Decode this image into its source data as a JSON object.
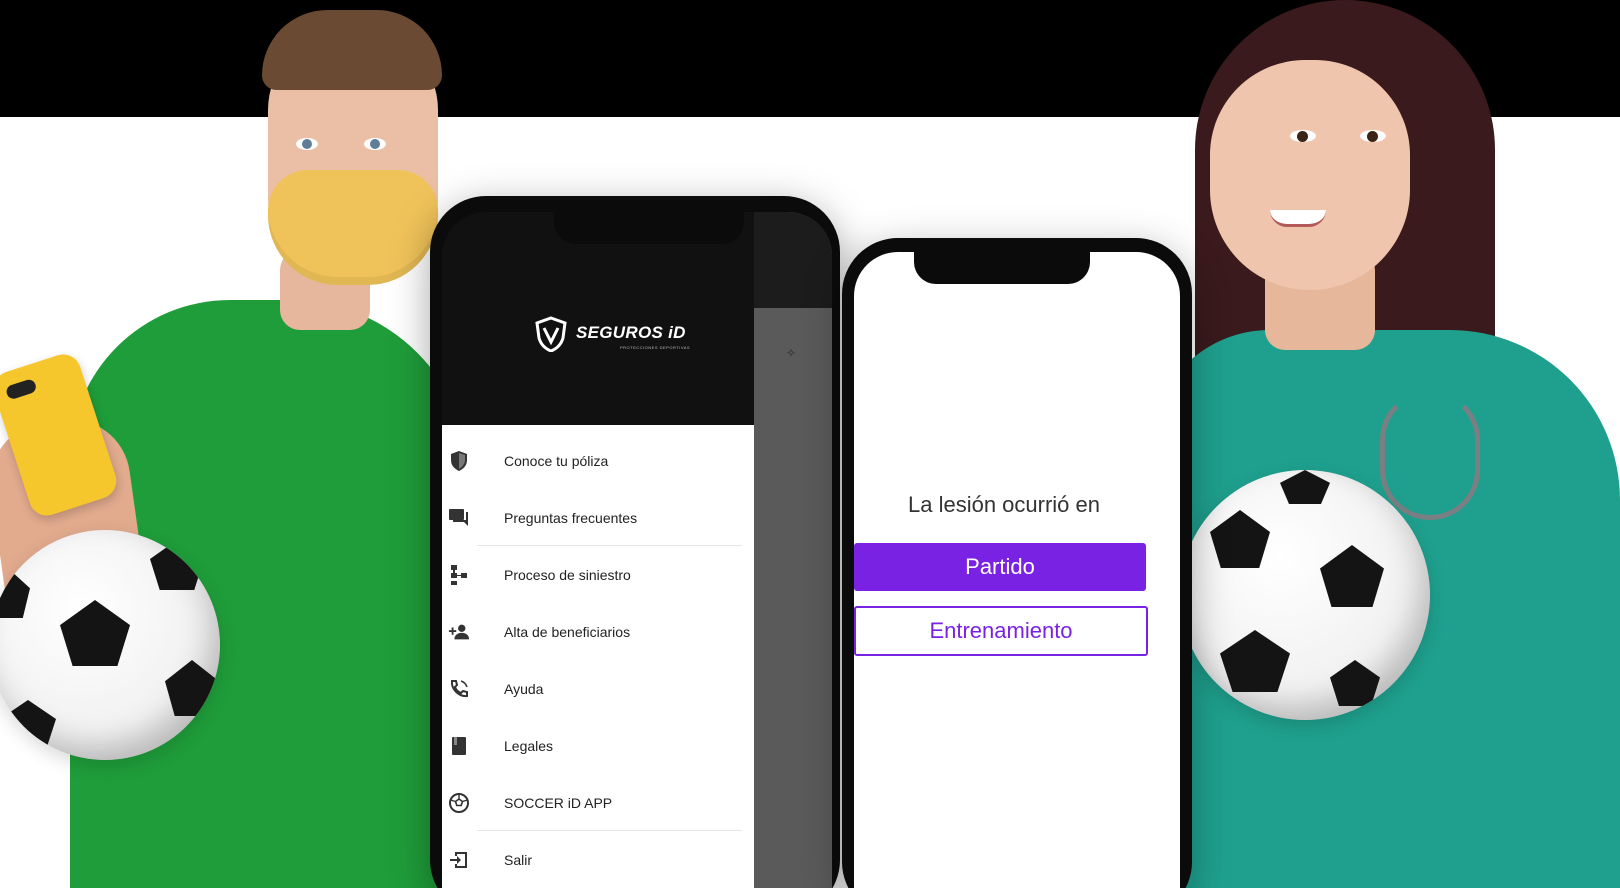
{
  "brand": {
    "name": "SEGUROS iD",
    "tagline": "PROTECCIONES DEPORTIVAS",
    "accent_color": "#7a22e3"
  },
  "menu": {
    "items": [
      {
        "label": "Conoce tu póliza",
        "icon": "shield-icon"
      },
      {
        "label": "Preguntas frecuentes",
        "icon": "chat-icon"
      },
      {
        "label": "Proceso de siniestro",
        "icon": "process-icon"
      },
      {
        "label": "Alta de beneficiarios",
        "icon": "add-person-icon"
      },
      {
        "label": "Ayuda",
        "icon": "phone-icon"
      },
      {
        "label": "Legales",
        "icon": "book-icon"
      },
      {
        "label": "SOCCER iD APP",
        "icon": "soccer-ball-icon"
      },
      {
        "label": "Salir",
        "icon": "exit-icon"
      }
    ]
  },
  "injury": {
    "question": "La lesión ocurrió en",
    "options": [
      "Partido",
      "Entrenamiento"
    ]
  }
}
